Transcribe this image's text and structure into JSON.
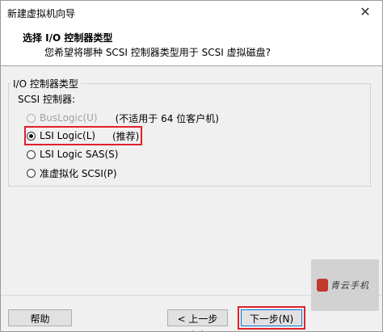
{
  "window": {
    "title": "新建虚拟机向导",
    "close_glyph": "✕"
  },
  "header": {
    "title": "选择 I/O 控制器类型",
    "subtitle": "您希望将哪种 SCSI 控制器类型用于 SCSI 虚拟磁盘?"
  },
  "group": {
    "label": "I/O 控制器类型",
    "scsi_label": "SCSI 控制器:",
    "options": [
      {
        "label": "BusLogic(U)",
        "note": "(不适用于 64 位客户机)",
        "state": "disabled",
        "selected": false
      },
      {
        "label": "LSI Logic(L)",
        "note": "(推荐)",
        "state": "enabled",
        "selected": true
      },
      {
        "label": "LSI Logic SAS(S)",
        "note": "",
        "state": "enabled",
        "selected": false
      },
      {
        "label": "准虚拟化 SCSI(P)",
        "note": "",
        "state": "enabled",
        "selected": false
      }
    ]
  },
  "buttons": {
    "help": "帮助",
    "back": "< 上一步(B)",
    "next": "下一步(N) >"
  },
  "watermark": {
    "text": "青云手机"
  },
  "colors": {
    "highlight": "#e0202a",
    "focus_border": "#0078d7"
  }
}
